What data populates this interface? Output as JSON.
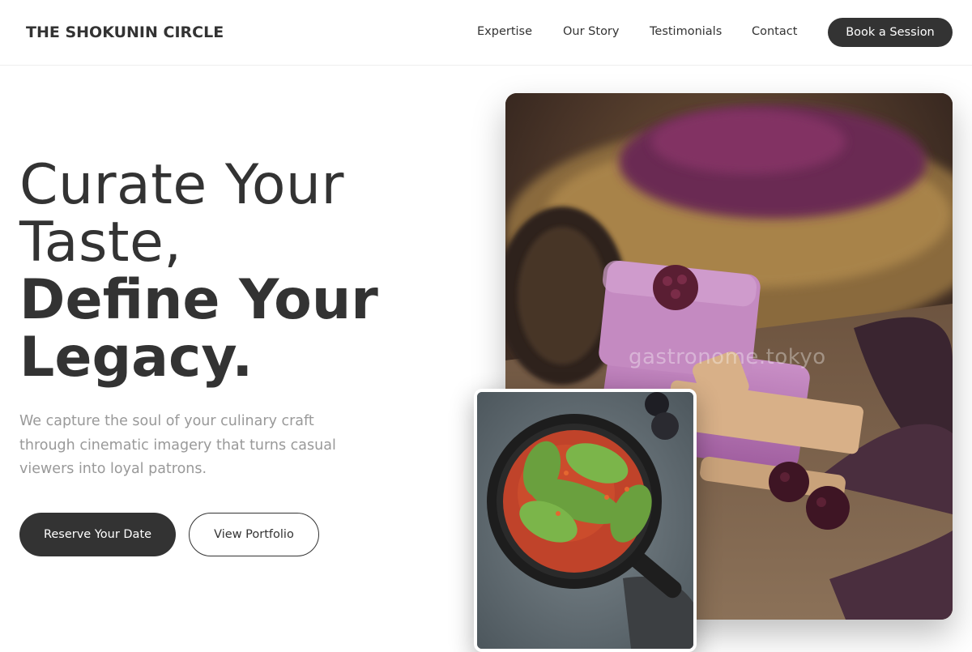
{
  "brand": {
    "name": "THE SHOKUNIN CIRCLE"
  },
  "nav": {
    "items": [
      {
        "label": "Expertise"
      },
      {
        "label": "Our Story"
      },
      {
        "label": "Testimonials"
      },
      {
        "label": "Contact"
      }
    ],
    "cta_label": "Book a Session"
  },
  "hero": {
    "headline_light_1": "Curate Your",
    "headline_light_2": "Taste,",
    "headline_bold_1": "Define Your",
    "headline_bold_2": "Legacy.",
    "subtext": "We capture the soul of your culinary craft through cinematic imagery that turns casual viewers into loyal patrons.",
    "primary_button": "Reserve Your Date",
    "secondary_button": "View Portfolio"
  },
  "images": {
    "main_watermark": "gastronome.tokyo",
    "main_icon": "purple-ice-cream-bars-photo",
    "secondary_icon": "cabbage-rolls-skillet-photo"
  },
  "colors": {
    "primary": "#333333",
    "muted_text": "#999999",
    "background": "#ffffff"
  }
}
